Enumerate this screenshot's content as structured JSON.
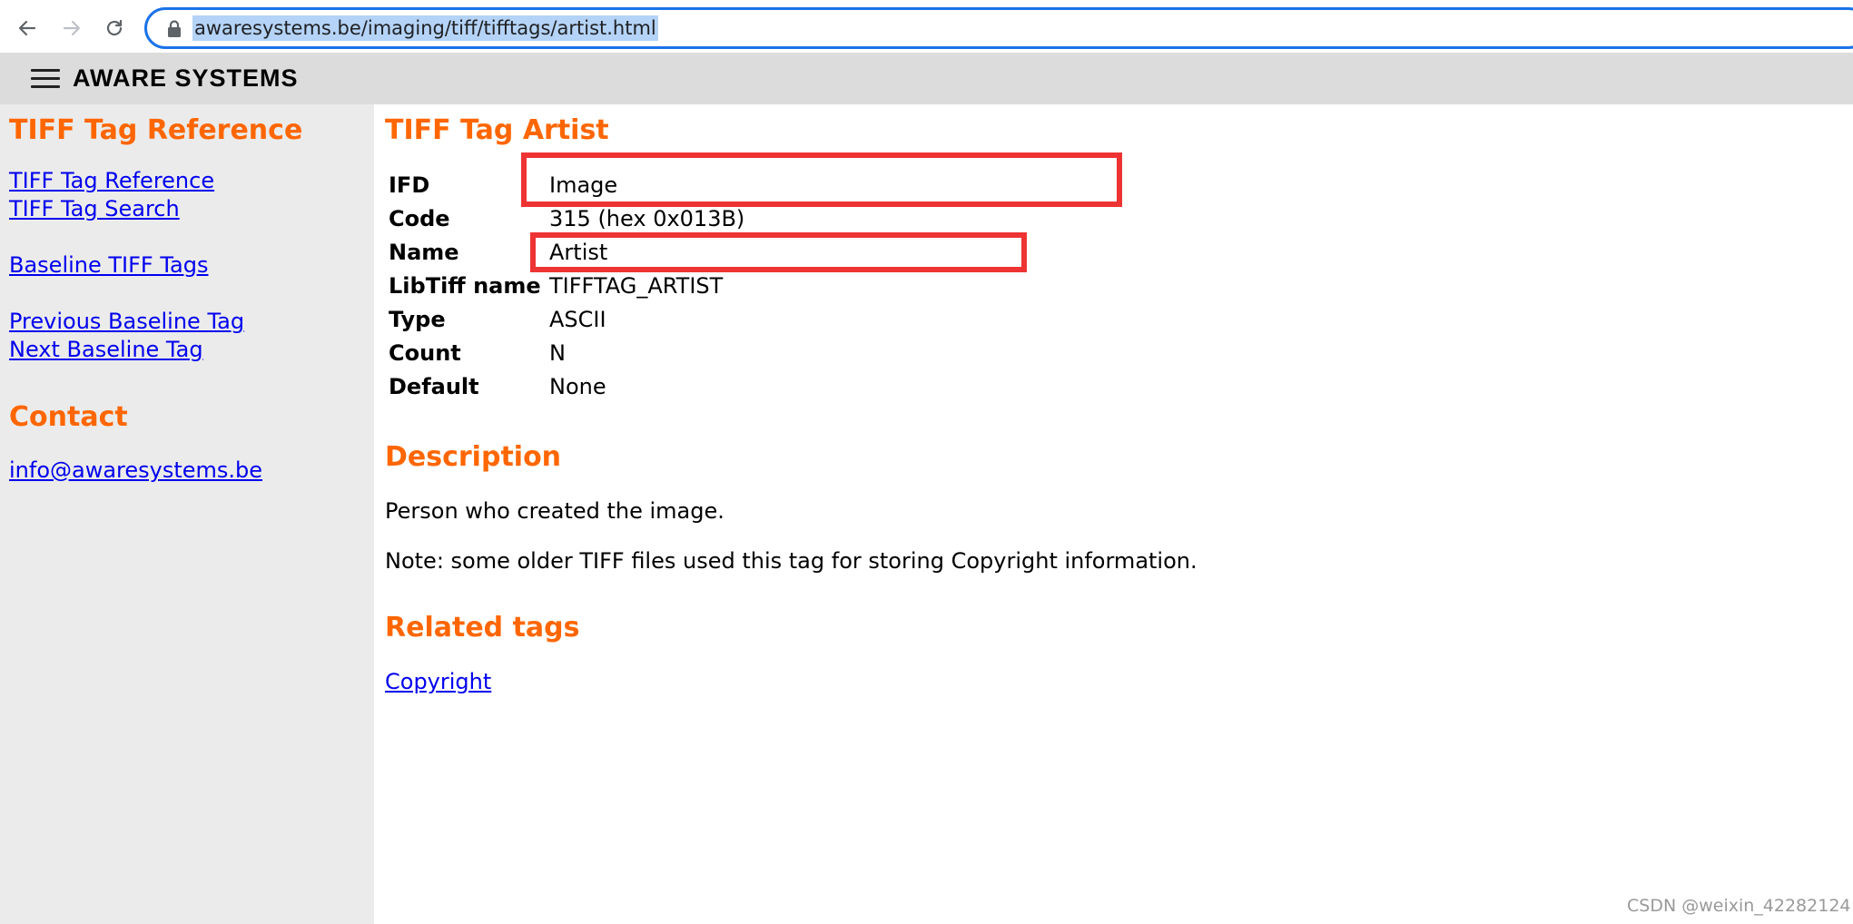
{
  "browser": {
    "url": "awaresystems.be/imaging/tiff/tifftags/artist.html"
  },
  "header": {
    "site_title": "AWARE SYSTEMS"
  },
  "sidebar": {
    "heading": "TIFF Tag Reference",
    "links": [
      "TIFF Tag Reference",
      "TIFF Tag Search",
      "Baseline TIFF Tags",
      "Previous Baseline Tag",
      "Next Baseline Tag"
    ],
    "contact_heading": "Contact",
    "contact_email": "info@awaresystems.be"
  },
  "main": {
    "title": "TIFF Tag Artist",
    "properties": [
      {
        "label": "IFD",
        "value": "Image"
      },
      {
        "label": "Code",
        "value": "315 (hex 0x013B)"
      },
      {
        "label": "Name",
        "value": "Artist"
      },
      {
        "label": "LibTiff name",
        "value": "TIFFTAG_ARTIST"
      },
      {
        "label": "Type",
        "value": "ASCII"
      },
      {
        "label": "Count",
        "value": "N"
      },
      {
        "label": "Default",
        "value": "None"
      }
    ],
    "description_heading": "Description",
    "description_paragraphs": [
      "Person who created the image.",
      "Note: some older TIFF files used this tag for storing Copyright information."
    ],
    "related_heading": "Related tags",
    "related_links": [
      "Copyright"
    ]
  },
  "watermark": "CSDN @weixin_42282124",
  "colors": {
    "accent_orange": "#ff6600",
    "link_blue": "#0000ee",
    "highlight_red": "#ee3333",
    "sidebar_bg": "#ebebeb",
    "header_bg": "#dcdcdc"
  },
  "icons": [
    "back-arrow-icon",
    "forward-arrow-icon",
    "reload-icon",
    "lock-icon",
    "hamburger-menu-icon"
  ]
}
